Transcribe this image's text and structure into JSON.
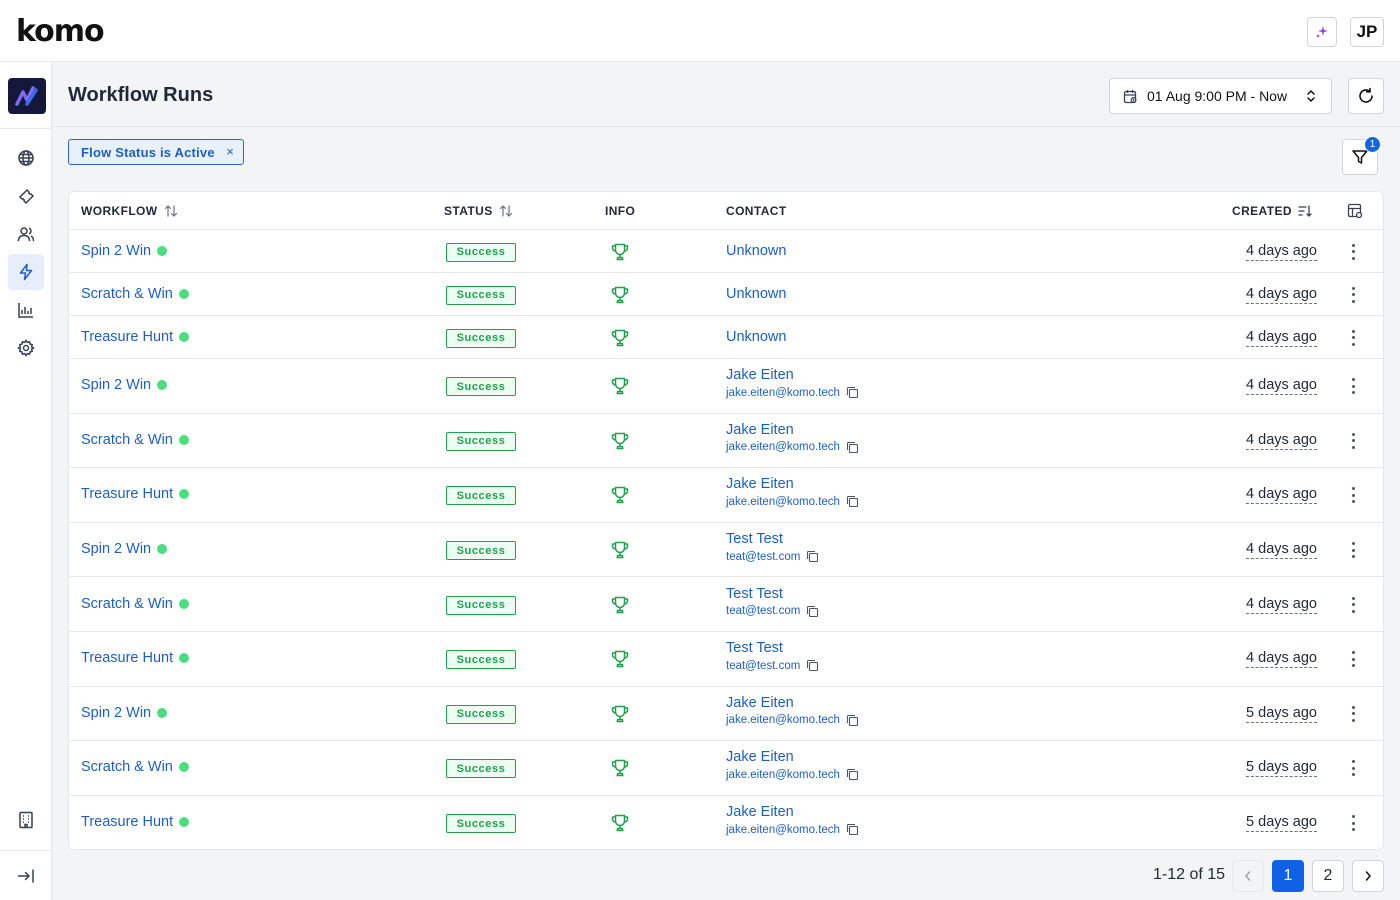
{
  "app": {
    "logo": "komo",
    "user_initials": "JP"
  },
  "page": {
    "title": "Workflow Runs"
  },
  "date_range": {
    "label": "01 Aug 9:00 PM - Now"
  },
  "filters": {
    "active_chip": "Flow Status is Active",
    "chip_remove": "×",
    "count": "1"
  },
  "table": {
    "columns": {
      "workflow": "WORKFLOW",
      "status": "STATUS",
      "info": "INFO",
      "contact": "CONTACT",
      "created": "CREATED"
    },
    "rows": [
      {
        "workflow": "Spin 2 Win",
        "status": "Success",
        "contact_name": "Unknown",
        "contact_email": "",
        "created": "4 days ago"
      },
      {
        "workflow": "Scratch & Win",
        "status": "Success",
        "contact_name": "Unknown",
        "contact_email": "",
        "created": "4 days ago"
      },
      {
        "workflow": "Treasure Hunt",
        "status": "Success",
        "contact_name": "Unknown",
        "contact_email": "",
        "created": "4 days ago"
      },
      {
        "workflow": "Spin 2 Win",
        "status": "Success",
        "contact_name": "Jake Eiten",
        "contact_email": "jake.eiten@komo.tech",
        "created": "4 days ago"
      },
      {
        "workflow": "Scratch & Win",
        "status": "Success",
        "contact_name": "Jake Eiten",
        "contact_email": "jake.eiten@komo.tech",
        "created": "4 days ago"
      },
      {
        "workflow": "Treasure Hunt",
        "status": "Success",
        "contact_name": "Jake Eiten",
        "contact_email": "jake.eiten@komo.tech",
        "created": "4 days ago"
      },
      {
        "workflow": "Spin 2 Win",
        "status": "Success",
        "contact_name": "Test Test",
        "contact_email": "teat@test.com",
        "created": "4 days ago"
      },
      {
        "workflow": "Scratch & Win",
        "status": "Success",
        "contact_name": "Test Test",
        "contact_email": "teat@test.com",
        "created": "4 days ago"
      },
      {
        "workflow": "Treasure Hunt",
        "status": "Success",
        "contact_name": "Test Test",
        "contact_email": "teat@test.com",
        "created": "4 days ago"
      },
      {
        "workflow": "Spin 2 Win",
        "status": "Success",
        "contact_name": "Jake Eiten",
        "contact_email": "jake.eiten@komo.tech",
        "created": "5 days ago"
      },
      {
        "workflow": "Scratch & Win",
        "status": "Success",
        "contact_name": "Jake Eiten",
        "contact_email": "jake.eiten@komo.tech",
        "created": "5 days ago"
      },
      {
        "workflow": "Treasure Hunt",
        "status": "Success",
        "contact_name": "Jake Eiten",
        "contact_email": "jake.eiten@komo.tech",
        "created": "5 days ago"
      }
    ]
  },
  "pagination": {
    "range": "1-12 of 15",
    "pages": [
      "1",
      "2"
    ],
    "current": "1"
  },
  "colors": {
    "link": "#1d5fc0",
    "success": "#22a04b",
    "accent": "#0f62e6",
    "brand_tile": "#14183a"
  },
  "icons": {
    "sidebar": [
      "globe-icon",
      "ticket-icon",
      "users-icon",
      "lightning-icon",
      "chart-icon",
      "gear-icon"
    ],
    "sidebar_bottom": [
      "building-icon",
      "collapse-sidebar-icon"
    ],
    "row": [
      "status-dot-icon",
      "trophy-icon",
      "copy-icon",
      "kebab-menu-icon"
    ]
  }
}
